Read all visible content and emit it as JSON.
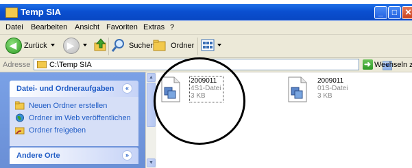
{
  "window": {
    "title": "Temp SIA",
    "minimize_glyph": "_",
    "maximize_glyph": "□",
    "close_glyph": "✕",
    "icon": "folder-icon"
  },
  "menu": [
    "Datei",
    "Bearbeiten",
    "Ansicht",
    "Favoriten",
    "Extras",
    "?"
  ],
  "toolbar": {
    "back_label": "Zurück",
    "back_arrow": "◀",
    "forward_arrow": "▶",
    "search_label": "Suchen",
    "folders_label": "Ordner"
  },
  "address": {
    "label": "Adresse",
    "value": "C:\\Temp SIA",
    "go_label": "Wechseln zu",
    "go_arrow": "➜"
  },
  "tasks": {
    "file_folder_tasks": {
      "title": "Datei- und Ordneraufgaben",
      "collapse_glyph": "«",
      "links": [
        {
          "label": "Neuen Ordner erstellen",
          "icon": "new-folder-icon"
        },
        {
          "label": "Ordner im Web veröffentlichen",
          "icon": "globe-icon"
        },
        {
          "label": "Ordner freigeben",
          "icon": "share-folder-icon"
        }
      ]
    },
    "other_places": {
      "title": "Andere Orte",
      "expand_glyph": "»"
    }
  },
  "scrollbar": {
    "up_glyph": "▲",
    "down_glyph": "▼"
  },
  "files": [
    {
      "name": "2009011",
      "type": "4S1-Datei",
      "size": "3 KB",
      "selected": true
    },
    {
      "name": "2009011",
      "type": "01S-Datei",
      "size": "3 KB",
      "selected": false
    }
  ],
  "colors": {
    "titlebar": "#0a4fd0",
    "taskpane": "#6a8fd6",
    "link": "#215dc6"
  }
}
